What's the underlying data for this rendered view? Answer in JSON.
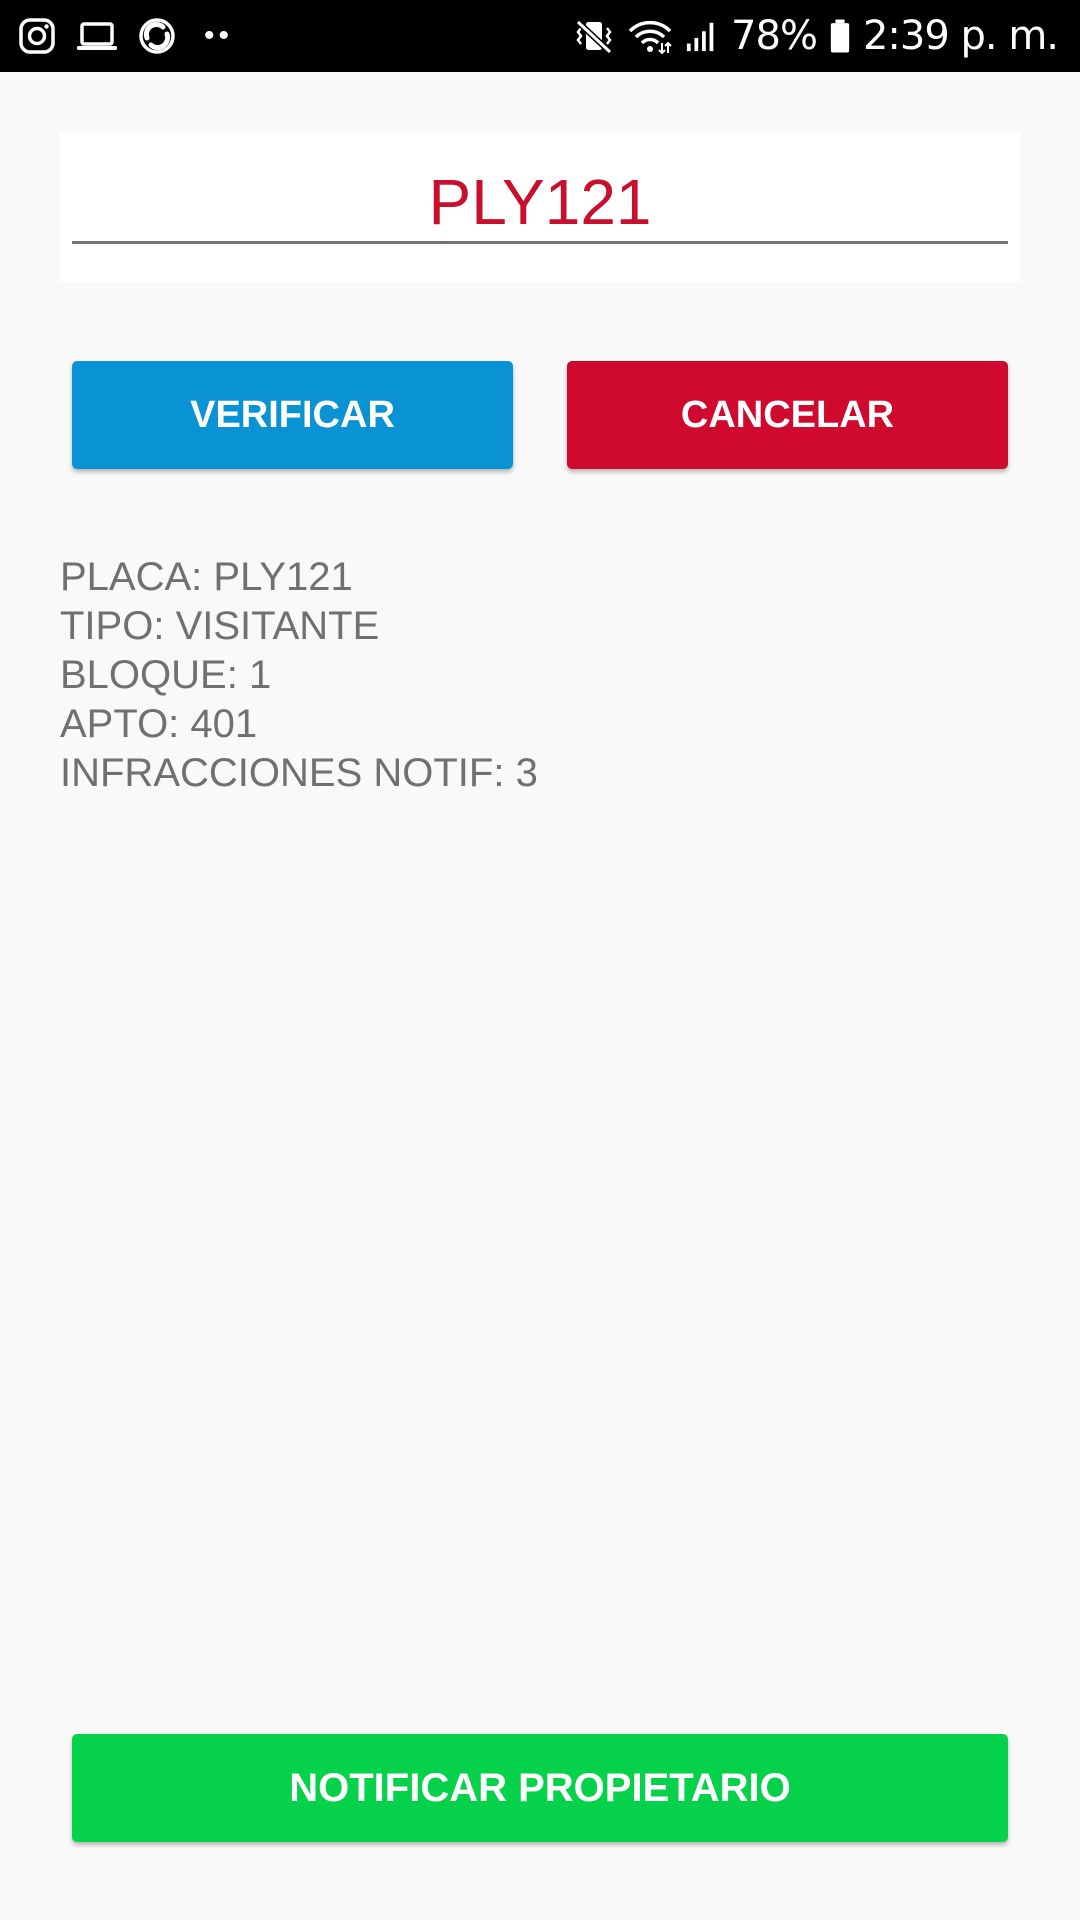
{
  "status_bar": {
    "battery": "78%",
    "time": "2:39 p. m.",
    "icons_left": [
      "instagram-icon",
      "laptop-icon",
      "sync-app-icon",
      "more-notifications-icon"
    ],
    "icons_right": [
      "vibrate-mute-icon",
      "wifi-icon",
      "signal-icon",
      "battery-icon"
    ]
  },
  "plate_input": {
    "value": "PLY121",
    "text_color": "#c8102e"
  },
  "buttons": {
    "verify": "VERIFICAR",
    "cancel": "CANCELAR",
    "notify": "NOTIFICAR PROPIETARIO"
  },
  "info": {
    "placa": "PLACA: PLY121",
    "tipo": "TIPO: VISITANTE",
    "bloque": "BLOQUE: 1",
    "apto": "APTO: 401",
    "infracciones": "INFRACCIONES NOTIF: 3"
  },
  "colors": {
    "verify": "#0a93d4",
    "cancel": "#d00a2e",
    "notify": "#06d14a",
    "background": "#f9f9f9"
  }
}
